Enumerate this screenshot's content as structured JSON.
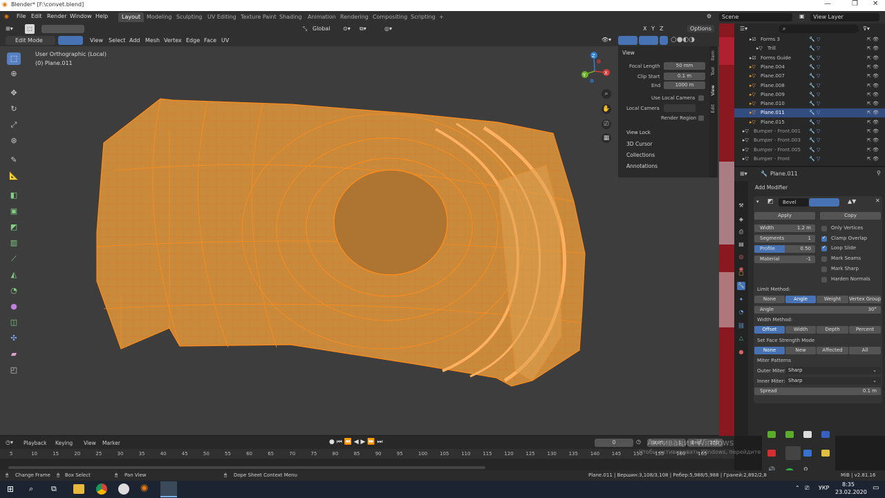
{
  "titlebar": {
    "title": "Blender* [F:\\convet.blend]",
    "minimize": "—",
    "restore": "❐",
    "close": "✕"
  },
  "menu": {
    "items": [
      "File",
      "Edit",
      "Render",
      "Window",
      "Help"
    ]
  },
  "workspaces": {
    "tabs": [
      "Layout",
      "Modeling",
      "Sculpting",
      "UV Editing",
      "Texture Paint",
      "Shading",
      "Animation",
      "Rendering",
      "Compositing",
      "Scripting"
    ],
    "add": "+"
  },
  "scene": {
    "label": "Scene",
    "view_layer": "View Layer"
  },
  "header1": {
    "orientation": "Global",
    "axes": [
      "X",
      "Y",
      "Z"
    ],
    "options": "Options"
  },
  "header2": {
    "mode": "Edit Mode",
    "menus": [
      "View",
      "Select",
      "Add",
      "Mesh",
      "Vertex",
      "Edge",
      "Face",
      "UV"
    ]
  },
  "viewport": {
    "overlay_title": "User Orthographic (Local)",
    "overlay_object": "(0) Plane.011",
    "gizmo": {
      "x": "X",
      "y": "Y",
      "z": "Z"
    }
  },
  "npanel": {
    "view_header": "View",
    "focal_label": "Focal Length",
    "focal_value": "50 mm",
    "clip_start_label": "Clip Start",
    "clip_start_value": "0.1 m",
    "end_label": "End",
    "end_value": "1000 m",
    "use_local_camera": "Use Local Camera",
    "local_camera": "Local Camera",
    "render_region": "Render Region",
    "view_lock": "View Lock",
    "sections": [
      "3D Cursor",
      "Collections",
      "Annotations"
    ]
  },
  "sidetabs": [
    "Item",
    "Tool",
    "View",
    "Edit"
  ],
  "outliner": {
    "rows": [
      {
        "name": "Forms 3",
        "indent": 1,
        "selected": false
      },
      {
        "name": "Trill",
        "indent": 2,
        "selected": false
      },
      {
        "name": "Forms Guide",
        "indent": 1,
        "selected": false
      },
      {
        "name": "Plane.004",
        "indent": 1,
        "selected": false
      },
      {
        "name": "Plane.007",
        "indent": 1,
        "selected": false
      },
      {
        "name": "Plane.008",
        "indent": 1,
        "selected": false
      },
      {
        "name": "Plane.009",
        "indent": 1,
        "selected": false
      },
      {
        "name": "Plane.010",
        "indent": 1,
        "selected": false
      },
      {
        "name": "Plane.011",
        "indent": 1,
        "selected": true
      },
      {
        "name": "Plane.015",
        "indent": 1,
        "selected": false
      },
      {
        "name": "Bumper - Front.001",
        "indent": 0,
        "selected": false
      },
      {
        "name": "Bumper - Front.003",
        "indent": 0,
        "selected": false
      },
      {
        "name": "Bumper - Front.005",
        "indent": 0,
        "selected": false
      },
      {
        "name": "Bumper - Front",
        "indent": 0,
        "selected": false
      }
    ]
  },
  "properties": {
    "object_name": "Plane.011",
    "add_modifier": "Add Modifier",
    "modifier_name": "Bevel",
    "apply": "Apply",
    "copy": "Copy",
    "width_label": "Width",
    "width_value": "1.2 m",
    "segments_label": "Segments",
    "segments_value": "1",
    "profile_label": "Profile",
    "profile_value": "0.50",
    "material_label": "Material",
    "material_value": "-1",
    "checks": [
      {
        "label": "Only Vertices",
        "on": false
      },
      {
        "label": "Clamp Overlap",
        "on": true
      },
      {
        "label": "Loop Slide",
        "on": true
      },
      {
        "label": "Mark Seams",
        "on": false
      },
      {
        "label": "Mark Sharp",
        "on": false
      },
      {
        "label": "Harden Normals",
        "on": false
      }
    ],
    "limit_method": "Limit Method:",
    "limit_opts": [
      "None",
      "Angle",
      "Weight",
      "Vertex Group"
    ],
    "angle_label": "Angle",
    "angle_value": "30°",
    "width_method": "Width Method:",
    "width_opts": [
      "Offset",
      "Width",
      "Depth",
      "Percent"
    ],
    "face_strength": "Set Face Strength Mode",
    "face_opts": [
      "None",
      "New",
      "Affected",
      "All"
    ],
    "miter_patterns": "Miter Patterns",
    "outer_miter_label": "Outer Miter:",
    "outer_miter_value": "Sharp",
    "inner_miter_label": "Inner Miter:",
    "inner_miter_value": "Sharp",
    "spread_label": "Spread",
    "spread_value": "0.1 m"
  },
  "timeline": {
    "menus": [
      "Playback",
      "Keying",
      "View",
      "Marker"
    ],
    "current_frame": "0",
    "start_label": "Start",
    "start_value": "1",
    "end_label": "End",
    "end_value": "250",
    "ticks": [
      "5",
      "10",
      "15",
      "20",
      "25",
      "30",
      "35",
      "40",
      "45",
      "50",
      "55",
      "60",
      "65",
      "70",
      "75",
      "80",
      "85",
      "90",
      "95",
      "100",
      "105",
      "110",
      "115",
      "120",
      "125",
      "130",
      "135",
      "140",
      "145",
      "150",
      "155",
      "160",
      "165"
    ]
  },
  "status": {
    "change_frame": "Change Frame",
    "box_select": "Box Select",
    "pan_view": "Pan View",
    "context_menu": "Dope Sheet Context Menu",
    "stats": "Plane.011 | Вершин:3,108/3,108 | Ребер:5,988/5,988 | Граней:2,892/2,8",
    "version": "MiB | v2.81.16"
  },
  "watermark": {
    "line1": "Активация Windows",
    "line2": "Чтобы активировать Windows, перейдите в раздел \"Параметры\"."
  },
  "taskbar": {
    "lang": "УКР",
    "time": "8:35",
    "date": "23.02.2020"
  },
  "colors": {
    "accent": "#4772b3",
    "selection": "#ff8c1a",
    "mesh_fill": "#c98a3c"
  }
}
